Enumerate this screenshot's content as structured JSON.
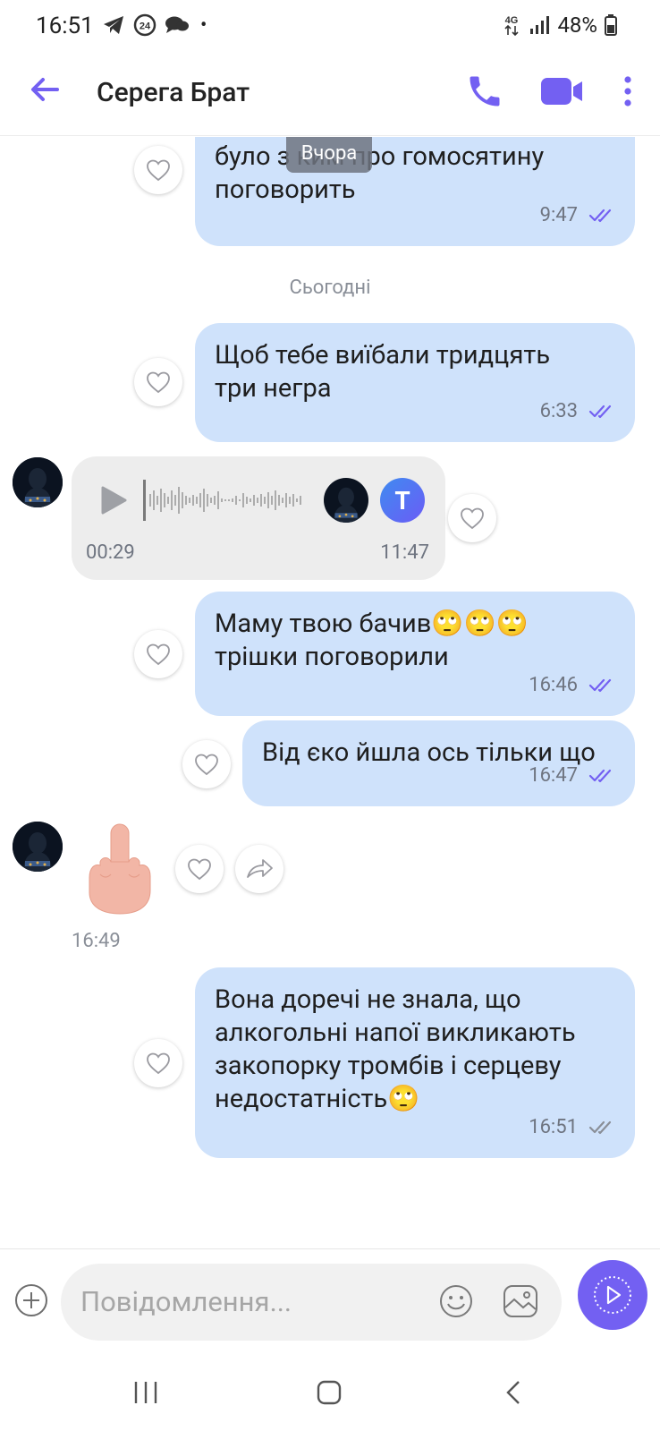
{
  "status_bar": {
    "time": "16:51",
    "network": "4G",
    "battery": "48%"
  },
  "header": {
    "contact_name": "Серега Брат"
  },
  "chat": {
    "partial_message": {
      "text": "було з ким про гомосятину\nпоговорить",
      "time": "9:47"
    },
    "floating_date": "Вчора",
    "date_separator": "Сьогодні",
    "messages": [
      {
        "text": "Щоб тебе виїбали тридцять\nтри негра",
        "time": "6:33"
      },
      {
        "text": "Маму твою бачив🙄🙄🙄\nтрішки поговорили",
        "time": "16:46"
      },
      {
        "text": "Від єко йшла ось тільки що",
        "time": "16:47"
      },
      {
        "text": "Вона доречі не знала, що\nалкогольні напої викликають\nзакопорку тромбів і серцеву\nнедостатність🙄",
        "time": "16:51"
      }
    ],
    "voice_message": {
      "duration": "00:29",
      "time": "11:47",
      "badge": "T"
    },
    "sticker_time": "16:49"
  },
  "input": {
    "placeholder": "Повідомлення..."
  },
  "colors": {
    "accent": "#7360f2",
    "outgoing_bubble": "#cfe2fb",
    "incoming_bubble": "#ededed"
  }
}
